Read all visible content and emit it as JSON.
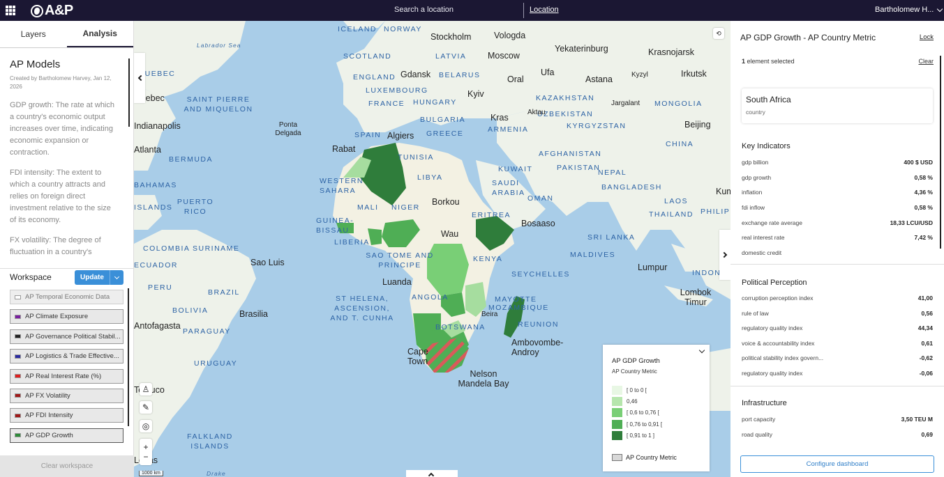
{
  "topbar": {
    "brand": "A&P",
    "search_label": "Search a location",
    "location_link": "Location",
    "user_name": "Bartholomew H..."
  },
  "left": {
    "tabs": [
      {
        "label": "Layers",
        "active": false
      },
      {
        "label": "Analysis",
        "active": true
      }
    ],
    "models": {
      "title": "AP Models",
      "meta": "Created by Bartholomew Harvey, Jan 12, 2026",
      "descriptions": [
        "GDP growth: The rate at which a country's economic output increases over time, indicating economic expansion or contraction.",
        "FDI intensity: The extent to which a country attracts and relies on foreign direct investment relative to the size of its economy.",
        "FX volatility: The degree of fluctuation in a country's"
      ]
    },
    "workspace": {
      "title": "Workspace",
      "update_label": "Update",
      "layers": [
        {
          "label": "AP Temporal Economic Data",
          "color": "#ffffff"
        },
        {
          "label": "AP Climate Exposure",
          "color": "#7a1fa0"
        },
        {
          "label": "AP Governance Political Stabil...",
          "color": "#222222"
        },
        {
          "label": "AP Logistics & Trade Effective...",
          "color": "#2a2aa0"
        },
        {
          "label": "AP Real Interest Rate (%)",
          "color": "#e02020"
        },
        {
          "label": "AP FX Volatility",
          "color": "#a01818"
        },
        {
          "label": "AP FDI Intensity",
          "color": "#a01818"
        },
        {
          "label": "AP GDP Growth",
          "color": "#2e8b3a"
        }
      ],
      "clear_label": "Clear workspace"
    }
  },
  "map": {
    "scale_label": "1000 km",
    "country_labels": [
      "ICELAND",
      "NORWAY",
      "SCOTLAND",
      "LATVIA",
      "ENGLAND",
      "BELARUS",
      "LUXEMBOURG",
      "FRANCE",
      "HUNGARY",
      "BULGARIA",
      "KAZAKHSTAN",
      "MONGOLIA",
      "UZBEKISTAN",
      "KYRGYZSTAN",
      "SPAIN",
      "GREECE",
      "ARMENIA",
      "CHINA",
      "TUNISIA",
      "AFGHANISTAN",
      "LIBYA",
      "KUWAIT",
      "PAKISTAN",
      "WESTERN SAHARA",
      "SAUDI ARABIA",
      "BANGLADESH",
      "NEPAL",
      "OMAN",
      "LAOS",
      "MALI",
      "NIGER",
      "ERITREA",
      "THAILAND",
      "PHILIPPINES",
      "GUINEA-BISSAU",
      "LIBERIA",
      "SRI LANKA",
      "SAO TOME AND PRINCIPE",
      "KENYA",
      "MALDIVES",
      "INDONESIA",
      "SEYCHELLES",
      "ANGOLA",
      "ST HELENA, ASCENSION, AND T. CUNHA",
      "MAYOTTE",
      "REUNION",
      "BOTSWANA",
      "SAINT PIERRE AND MIQUELON",
      "BERMUDA",
      "BAHAMAS",
      "ISLANDS",
      "PUERTO RICO",
      "COLOMBIA",
      "SURINAME",
      "ECUADOR",
      "PERU",
      "BRAZIL",
      "BOLIVIA",
      "PARAGUAY",
      "URUGUAY",
      "FALKLAND ISLANDS",
      "QUEBEC",
      "MOZAMBIQUE"
    ],
    "city_labels": [
      "Stockholm",
      "Vologda",
      "Moscow",
      "Yekaterinburg",
      "Krasnojarsk",
      "Gdansk",
      "Ufa",
      "Irkutsk",
      "Oral",
      "Kyzyl",
      "Kyiv",
      "Astana",
      "Jargalant",
      "Kras",
      "Aktau",
      "Beijing",
      "Algiers",
      "Ponta Delgada",
      "Rabat",
      "Borkou",
      "Wau",
      "Bosaaso",
      "Kuming",
      "Lumpur",
      "Luanda",
      "Lombok Timur",
      "Cape Town",
      "Nelson Mandela Bay",
      "Ambovombe-Androy",
      "Sao Luis",
      "Brasilia",
      "Quebec",
      "Indianapolis",
      "Atlanta",
      "Antofagasta",
      "Temuco",
      "Lenas",
      "Beira"
    ],
    "sea_labels": [
      "Labrador Sea",
      "Drake"
    ],
    "legend": {
      "title": "AP GDP Growth",
      "subtitle": "AP Country Metric",
      "items": [
        {
          "label": "[ 0 to 0 [",
          "color": "#e8f7e4"
        },
        {
          "label": "0,46",
          "color": "#b6e6ad"
        },
        {
          "label": "[ 0,6 to 0,76 [",
          "color": "#79cf76"
        },
        {
          "label": "[ 0,76 to 0,91 [",
          "color": "#4fae55"
        },
        {
          "label": "[ 0,91 to 1 ]",
          "color": "#2f7d3b"
        }
      ],
      "footer": "AP Country Metric"
    }
  },
  "right": {
    "title": "AP GDP Growth - AP Country Metric",
    "lock_label": "Lock",
    "selection_count": "1",
    "selection_text": "element selected",
    "clear_label": "Clear",
    "country": {
      "name": "South Africa",
      "type": "country"
    },
    "sections": [
      {
        "title": "Key Indicators",
        "rows": [
          {
            "k": "gdp billion",
            "v": "400 $ USD"
          },
          {
            "k": "gdp growth",
            "v": "0,58 %"
          },
          {
            "k": "inflation",
            "v": "4,36 %"
          },
          {
            "k": "fdi inflow",
            "v": "0,58 %"
          },
          {
            "k": "exchange rate average",
            "v": "18,33 LCU/USD"
          },
          {
            "k": "real interest rate",
            "v": "7,42 %"
          },
          {
            "k": "domestic credit",
            "v": ""
          }
        ]
      },
      {
        "title": "Political Perception",
        "rows": [
          {
            "k": "corruption perception index",
            "v": "41,00"
          },
          {
            "k": "rule of law",
            "v": "0,56"
          },
          {
            "k": "regulatory quality index",
            "v": "44,34"
          },
          {
            "k": "voice & accountability index",
            "v": "0,61"
          },
          {
            "k": "political stability index govern...",
            "v": "-0,62"
          },
          {
            "k": "regulatory quality index",
            "v": "-0,06"
          }
        ]
      },
      {
        "title": "Infrastructure",
        "rows": [
          {
            "k": "port capacity",
            "v": "3,50 TEU M"
          },
          {
            "k": "road quality",
            "v": "0,69"
          }
        ]
      }
    ],
    "config_label": "Configure dashboard"
  }
}
